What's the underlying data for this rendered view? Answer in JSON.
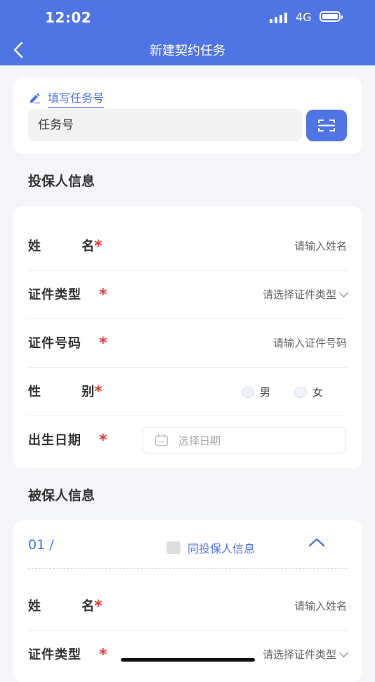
{
  "status": {
    "time": "12:02",
    "network": "4G"
  },
  "header": {
    "title": "新建契约任务"
  },
  "task": {
    "label": "填写任务号",
    "placeholder": "任务号"
  },
  "policyholder": {
    "section_title": "投保人信息",
    "name_label": "姓 名",
    "name_placeholder": "请输入姓名",
    "idtype_label": "证件类型",
    "idtype_placeholder": "请选择证件类型",
    "idno_label": "证件号码",
    "idno_placeholder": "请输入证件号码",
    "gender_label": "性 别",
    "gender_options": [
      "男",
      "女"
    ],
    "birth_label": "出生日期",
    "birth_placeholder": "选择日期"
  },
  "insured": {
    "section_title": "被保人信息",
    "index": "01 /",
    "same_as_label": "同投保人信息",
    "name_label": "姓 名",
    "name_placeholder": "请输入姓名",
    "idtype_label": "证件类型",
    "idtype_placeholder": "请选择证件类型"
  },
  "required_mark": "*",
  "colors": {
    "accent": "#4f74e3",
    "required": "#e53935",
    "background": "#f3f5f9"
  }
}
